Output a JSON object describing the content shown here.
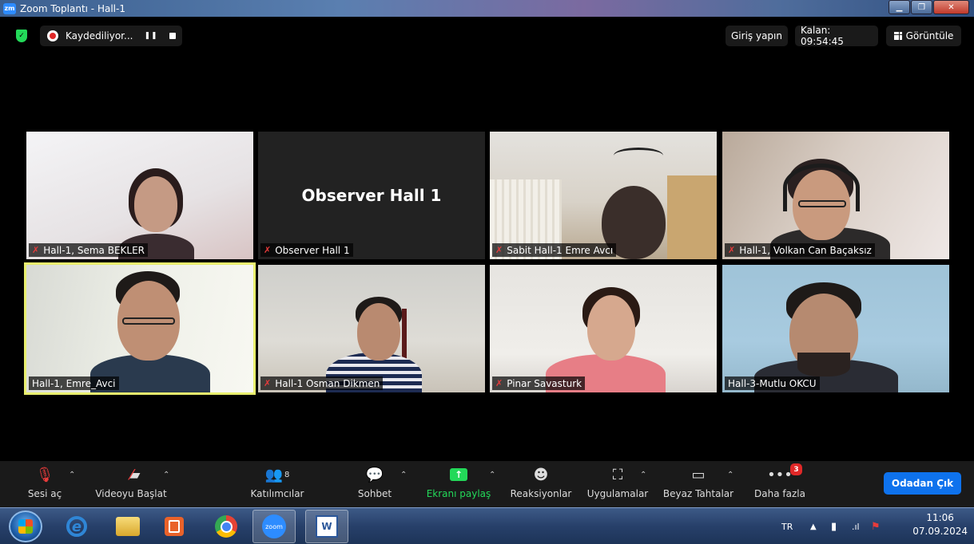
{
  "window": {
    "title": "Zoom Toplantı - Hall-1",
    "logo_text": "zm"
  },
  "topbar": {
    "recording_label": "Kaydediliyor...",
    "pause_symbol": "❚❚",
    "signin_label": "Giriş yapın",
    "remaining_label": "Kalan: 09:54:45",
    "view_label": "Görüntüle"
  },
  "tiles": [
    {
      "name": "Hall-1, Sema BEKLER",
      "muted": true
    },
    {
      "name": "Observer Hall 1",
      "center_label": "Observer Hall 1",
      "muted": true
    },
    {
      "name": "Sabit Hall-1 Emre Avcı",
      "muted": true
    },
    {
      "name": "Hall-1, Volkan Can Baçaksız",
      "muted": true
    },
    {
      "name": "Hall-1, Emre_Avci",
      "muted": false,
      "active_speaker": true
    },
    {
      "name": "Hall-1 Osman Dikmen",
      "muted": true
    },
    {
      "name": "Pinar Savasturk",
      "muted": true
    },
    {
      "name": "Hall-3-Mutlu OKCU",
      "muted": false
    }
  ],
  "toolbar": {
    "audio_label": "Sesi aç",
    "video_label": "Videoyu Başlat",
    "participants_label": "Katılımcılar",
    "participants_count": "8",
    "chat_label": "Sohbet",
    "share_label": "Ekranı paylaş",
    "reactions_label": "Reaksiyonlar",
    "apps_label": "Uygulamalar",
    "whiteboard_label": "Beyaz Tahtalar",
    "more_label": "Daha fazla",
    "more_badge": "3",
    "leave_label": "Odadan Çık"
  },
  "taskbar": {
    "zoom_app_text": "zoom",
    "word_app_text": "W",
    "language": "TR",
    "time": "11:06",
    "date": "07.09.2024"
  },
  "colors": {
    "accent_green": "#23d959",
    "leave_blue": "#0e72ed",
    "mute_red": "#e83b3b",
    "active_speaker_border": "#e9ef6e"
  }
}
